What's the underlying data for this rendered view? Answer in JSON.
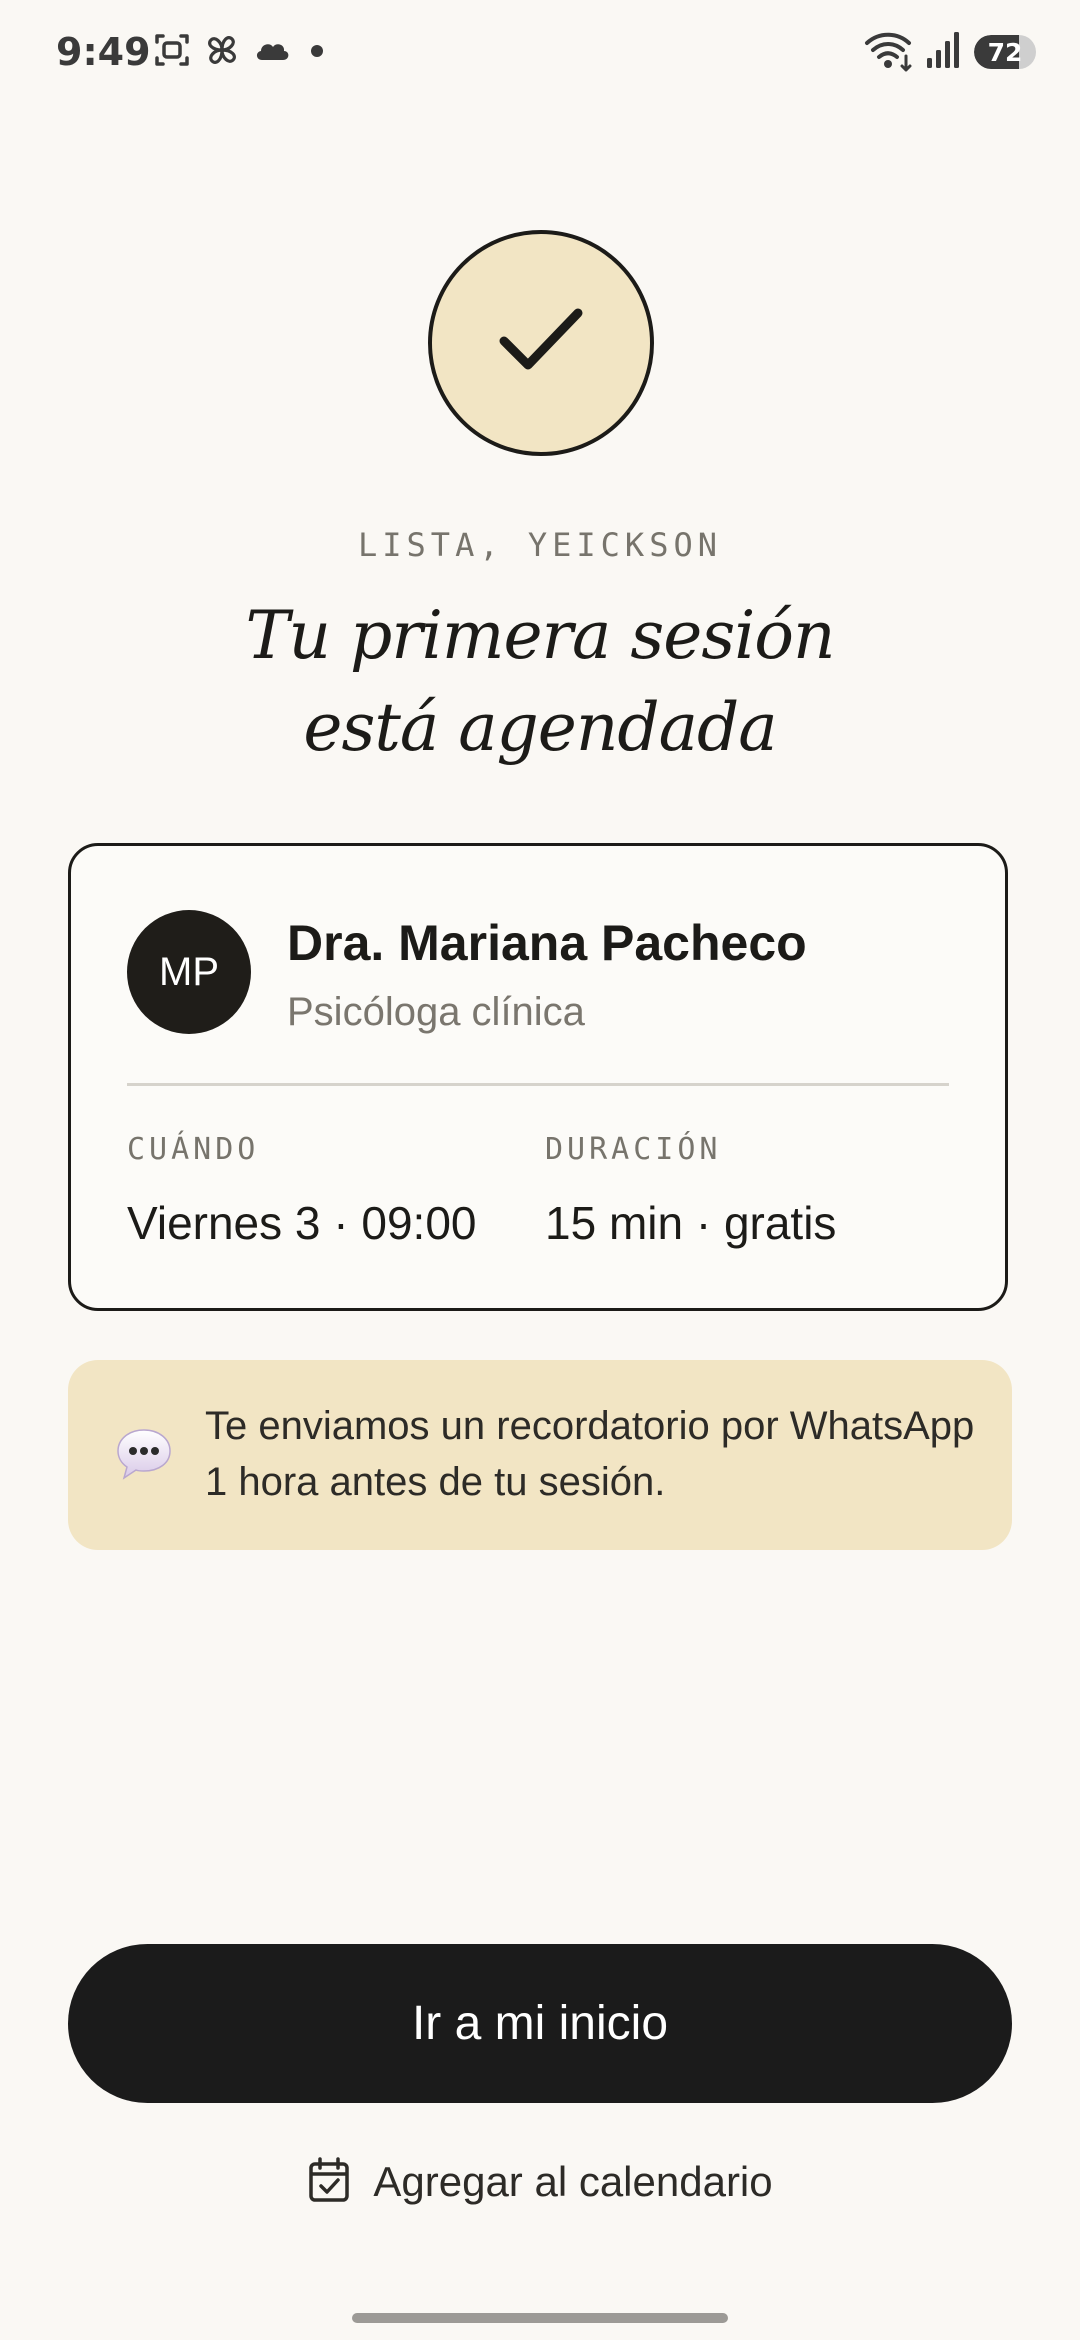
{
  "status_bar": {
    "time": "9:49",
    "battery_level": "72",
    "battery_fraction": 0.72,
    "left_icons": [
      "screenshot-icon",
      "pinwheel-icon",
      "cloud-icon",
      "dot-icon"
    ],
    "right_icons": [
      "wifi-icon",
      "signal-icon",
      "battery-icon"
    ]
  },
  "confirmation": {
    "icon": "checkmark-icon",
    "eyebrow": "LISTA, YEICKSON",
    "title_line1": "Tu primera sesión",
    "title_line2": "está agendada"
  },
  "card": {
    "avatar_initials": "MP",
    "doctor_name": "Dra. Mariana Pacheco",
    "doctor_role": "Psicóloga clínica",
    "when_label": "CUÁNDO",
    "when_value": "Viernes 3 · 09:00",
    "duration_label": "DURACIÓN",
    "duration_value": "15 min · gratis"
  },
  "reminder": {
    "icon": "speech-bubble-icon",
    "text": "Te enviamos un recordatorio por WhatsApp 1 hora antes de tu sesión."
  },
  "actions": {
    "primary_label": "Ir a mi inicio",
    "secondary_label": "Agregar al calendario",
    "secondary_icon": "calendar-check-icon"
  },
  "colors": {
    "background": "#faf8f4",
    "accent_cream": "#f2e5c4",
    "dark": "#1b1b1b",
    "muted_text": "#77746c"
  }
}
